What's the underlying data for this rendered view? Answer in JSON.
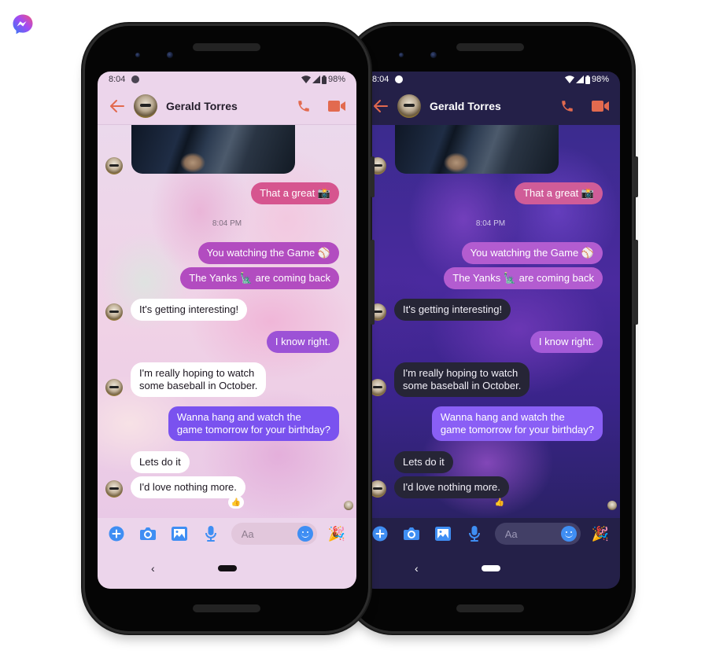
{
  "brand": {
    "icon": "messenger-logo-icon",
    "gradient": [
      "#2f7bf5",
      "#a34bf3",
      "#f5537a"
    ]
  },
  "phones": [
    {
      "theme": "light",
      "status_bar": {
        "time": "8:04",
        "battery": "98%",
        "icons": [
          "messenger-icon",
          "wifi-icon",
          "signal-icon",
          "battery-icon"
        ]
      },
      "header": {
        "contact_name": "Gerald Torres",
        "back_icon": "arrow-left-icon",
        "actions": [
          "phone-call-icon",
          "video-call-icon"
        ],
        "accent_color": "#e26a4f"
      },
      "thread": {
        "media": {
          "type": "photo"
        },
        "messages": [
          {
            "direction": "out",
            "text": "That a great 📸"
          },
          {
            "type": "timestamp",
            "text": "8:04 PM"
          },
          {
            "direction": "out",
            "text": "You watching the Game ⚾"
          },
          {
            "direction": "out",
            "text": "The Yanks 🗽 are coming back"
          },
          {
            "direction": "in",
            "text": "It's getting interesting!"
          },
          {
            "direction": "out",
            "text": "I know right."
          },
          {
            "direction": "in",
            "text": "I'm really hoping to watch\nsome baseball in October."
          },
          {
            "direction": "out",
            "text": "Wanna hang and watch the\ngame tomorrow for your birthday?"
          },
          {
            "direction": "in",
            "text": "Lets do it"
          },
          {
            "direction": "in",
            "text": "I'd love nothing more.",
            "reaction": "👍"
          }
        ]
      },
      "composer": {
        "placeholder": "Aa",
        "tools": [
          "plus-icon",
          "camera-icon",
          "gallery-icon",
          "microphone-icon"
        ],
        "emoji_icon": "smiley-icon",
        "quick_reaction": "🎉",
        "tool_color": "#3f8ef3"
      },
      "nav": {
        "back": "‹"
      }
    },
    {
      "theme": "dark",
      "status_bar": {
        "time": "8:04",
        "battery": "98%",
        "icons": [
          "messenger-icon",
          "wifi-icon",
          "signal-icon",
          "battery-icon"
        ]
      },
      "header": {
        "contact_name": "Gerald Torres",
        "back_icon": "arrow-left-icon",
        "actions": [
          "phone-call-icon",
          "video-call-icon"
        ],
        "accent_color": "#e26a4f"
      },
      "thread": {
        "media": {
          "type": "photo"
        },
        "messages": [
          {
            "direction": "out",
            "text": "That a great 📸"
          },
          {
            "type": "timestamp",
            "text": "8:04 PM"
          },
          {
            "direction": "out",
            "text": "You watching the Game ⚾"
          },
          {
            "direction": "out",
            "text": "The Yanks 🗽 are coming back"
          },
          {
            "direction": "in",
            "text": "It's getting interesting!"
          },
          {
            "direction": "out",
            "text": "I know right."
          },
          {
            "direction": "in",
            "text": "I'm really hoping to watch\nsome baseball in October."
          },
          {
            "direction": "out",
            "text": "Wanna hang and watch the\ngame tomorrow for your birthday?"
          },
          {
            "direction": "in",
            "text": "Lets do it"
          },
          {
            "direction": "in",
            "text": "I'd love nothing more.",
            "reaction": "👍"
          }
        ]
      },
      "composer": {
        "placeholder": "Aa",
        "tools": [
          "plus-icon",
          "camera-icon",
          "gallery-icon",
          "microphone-icon"
        ],
        "emoji_icon": "smiley-icon",
        "quick_reaction": "🎉",
        "tool_color": "#3f8ef3"
      },
      "nav": {
        "back": "‹"
      }
    }
  ]
}
